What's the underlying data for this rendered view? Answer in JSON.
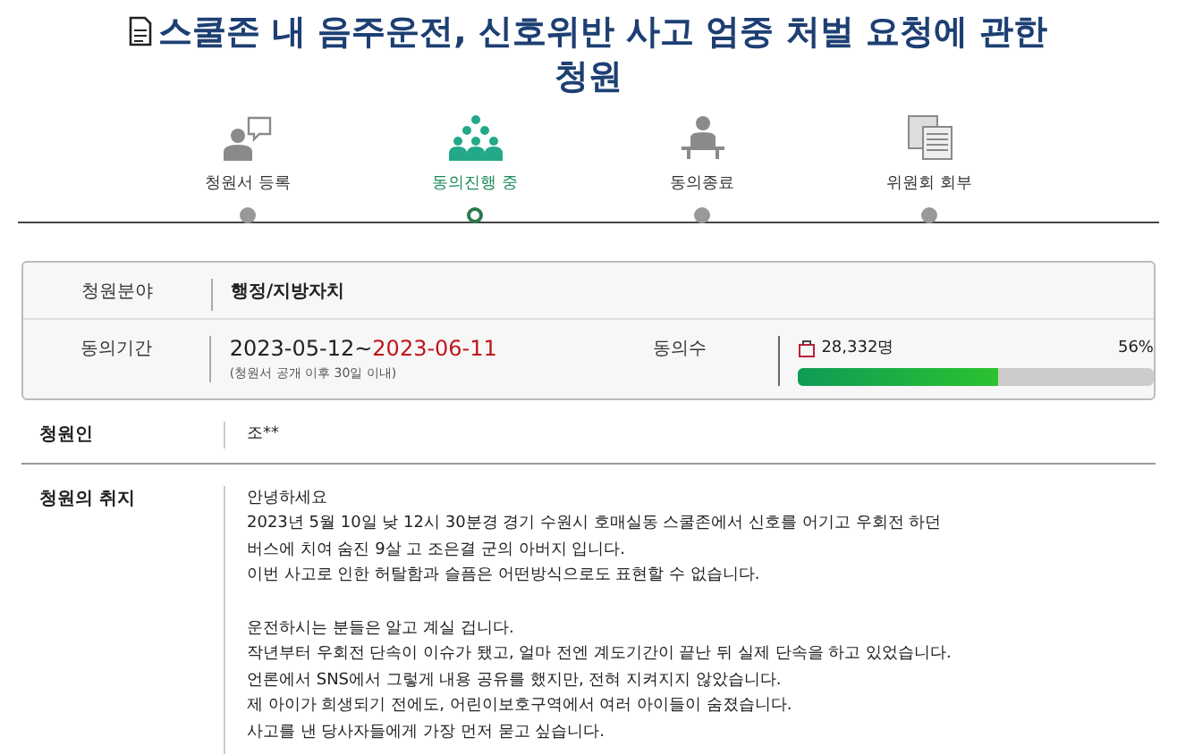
{
  "title": "스쿨존 내 음주운전, 신호위반 사고 엄중 처벌 요청에 관한 청원",
  "steps": [
    {
      "label": "청원서 등록",
      "selected": false
    },
    {
      "label": "동의진행 중",
      "selected": true
    },
    {
      "label": "동의종료",
      "selected": false
    },
    {
      "label": "위원회 회부",
      "selected": false
    }
  ],
  "info": {
    "field_label": "청원분야",
    "field_value": "행정/지방자치",
    "period_label": "동의기간",
    "period_start": "2023-05-12~",
    "period_end": "2023-06-11",
    "period_note": "(청원서 공개 이후 30일 이내)",
    "count_label": "동의수",
    "count": "28,332명",
    "percent": "56%",
    "level": 0.56
  },
  "petitioner": {
    "label": "청원인",
    "value": "조**"
  },
  "purpose": {
    "label": "청원의 취지",
    "paragraphs": [
      [
        "안녕하세요",
        "2023년 5월 10일 낮 12시 30분경 경기 수원시 호매실동 스쿨존에서 신호를 어기고 우회전 하던",
        "버스에 치여 숨진 9살 고 조은결 군의 아버지 입니다.",
        "이번 사고로 인한 허탈함과 슬픔은 어떤방식으로도 표현할 수 없습니다."
      ],
      [
        "운전하시는 분들은 알고 계실 겁니다.",
        "작년부터 우회전 단속이 이슈가 됐고, 얼마 전엔 계도기간이 끝난 뒤 실제 단속을 하고 있었습니다.",
        "언론에서 SNS에서 그렇게 내용 공유를 했지만, 전혀 지켜지지 않았습니다.",
        "제 아이가 희생되기 전에도, 어린이보호구역에서 여러 아이들이 숨졌습니다.",
        "사고를 낸 당사자들에게 가장 먼저 묻고 싶습니다."
      ]
    ]
  }
}
